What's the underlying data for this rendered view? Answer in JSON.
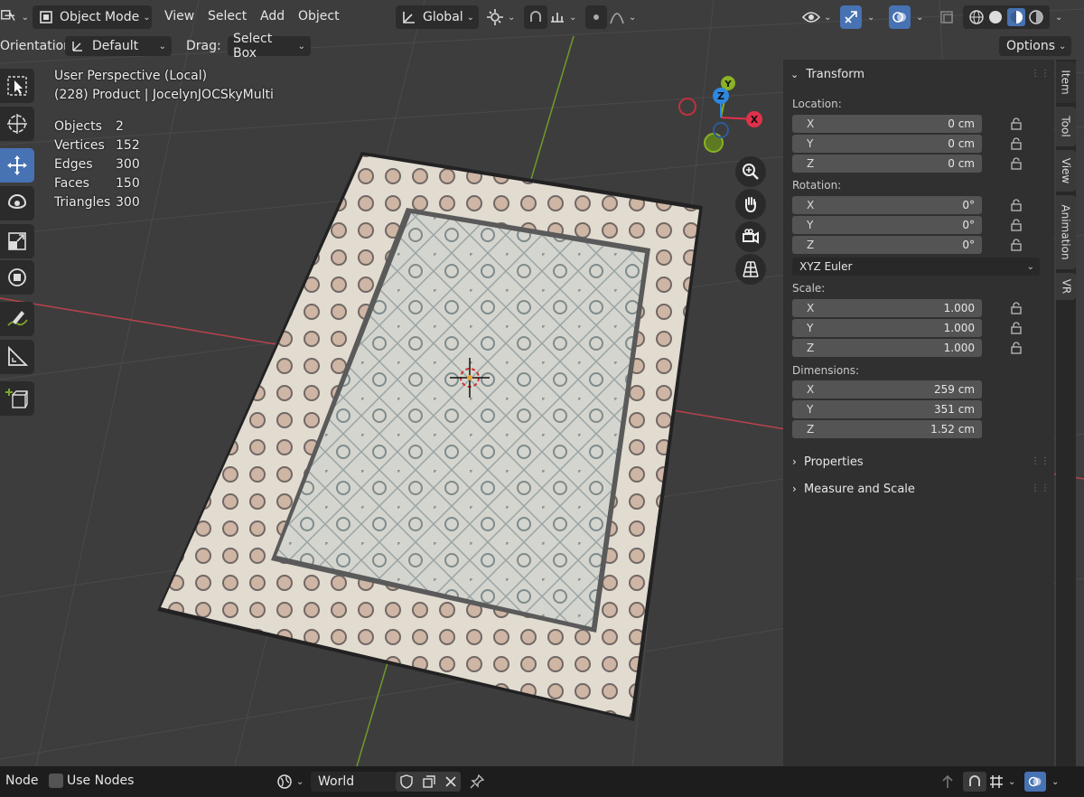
{
  "header": {
    "mode": "Object Mode",
    "menus": [
      "View",
      "Select",
      "Add",
      "Object"
    ],
    "transform_orientation": "Global",
    "icons": [
      "editor-type-icon",
      "mode-icon",
      "orientation-icon",
      "pivot-icon",
      "snap-icon",
      "proportional-icon",
      "visibility-icon",
      "gizmo-icon",
      "overlay-icon",
      "xray-icon",
      "shading-wireframe-icon",
      "shading-solid-icon",
      "shading-material-icon",
      "shading-rendered-icon"
    ]
  },
  "toolbar_row": {
    "orientation_label": "Orientation:",
    "orientation_value": "Default",
    "drag_label": "Drag:",
    "drag_value": "Select Box",
    "options_label": "Options"
  },
  "viewport_info": {
    "view_name": "User Perspective (Local)",
    "object_name": "(228) Product | JocelynJOCSkyMulti",
    "stats": [
      {
        "label": "Objects",
        "value": "2"
      },
      {
        "label": "Vertices",
        "value": "152"
      },
      {
        "label": "Edges",
        "value": "300"
      },
      {
        "label": "Faces",
        "value": "150"
      },
      {
        "label": "Triangles",
        "value": "300"
      }
    ]
  },
  "gizmo": {
    "x": "X",
    "y": "Y",
    "z": "Z",
    "colors": {
      "x": "#e0314a",
      "y": "#89b224",
      "z": "#2e87e0"
    }
  },
  "transform_panel": {
    "title": "Transform",
    "location_label": "Location:",
    "location": [
      {
        "axis": "X",
        "value": "0 cm"
      },
      {
        "axis": "Y",
        "value": "0 cm"
      },
      {
        "axis": "Z",
        "value": "0 cm"
      }
    ],
    "rotation_label": "Rotation:",
    "rotation": [
      {
        "axis": "X",
        "value": "0°"
      },
      {
        "axis": "Y",
        "value": "0°"
      },
      {
        "axis": "Z",
        "value": "0°"
      }
    ],
    "rotation_mode": "XYZ Euler",
    "scale_label": "Scale:",
    "scale": [
      {
        "axis": "X",
        "value": "1.000"
      },
      {
        "axis": "Y",
        "value": "1.000"
      },
      {
        "axis": "Z",
        "value": "1.000"
      }
    ],
    "dimensions_label": "Dimensions:",
    "dimensions": [
      {
        "axis": "X",
        "value": "259 cm"
      },
      {
        "axis": "Y",
        "value": "351 cm"
      },
      {
        "axis": "Z",
        "value": "1.52 cm"
      }
    ],
    "properties_label": "Properties",
    "measure_label": "Measure and Scale"
  },
  "side_tabs": [
    "Item",
    "Tool",
    "View",
    "Animation",
    "VR"
  ],
  "bottom_bar": {
    "node_label": "Node",
    "use_nodes_label": "Use Nodes",
    "world_value": "World"
  },
  "colors": {
    "accent": "#4772b3",
    "x_axis": "#d0474f",
    "y_axis": "#7ea42c"
  }
}
